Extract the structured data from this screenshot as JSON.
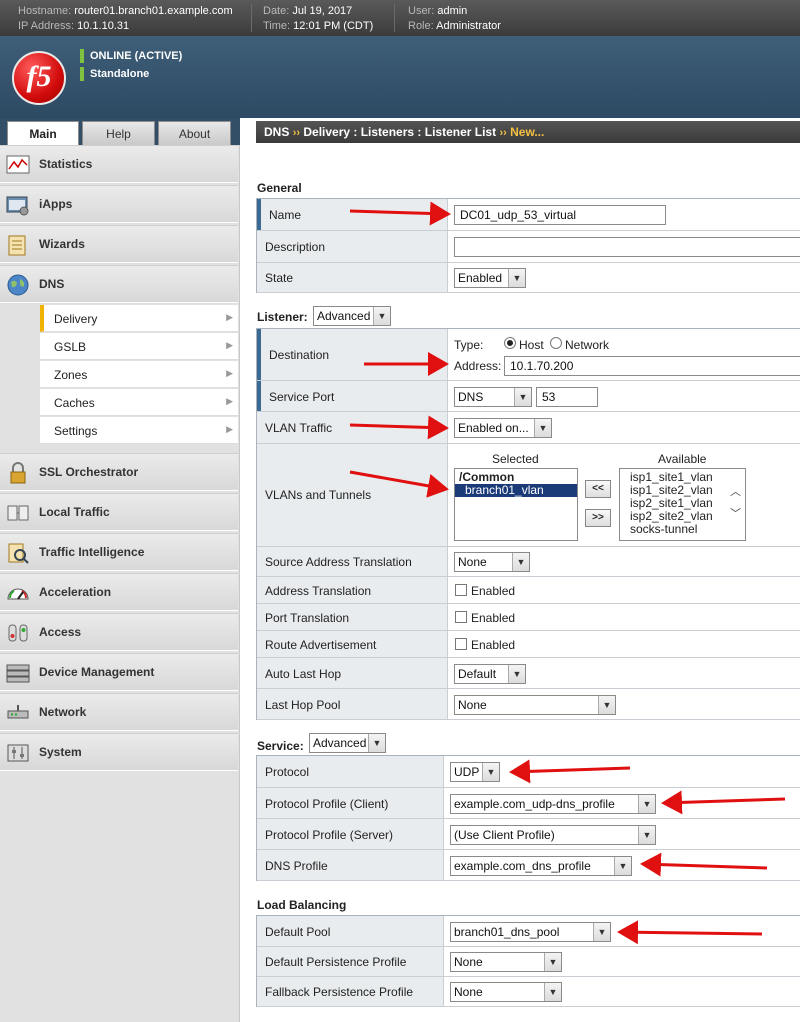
{
  "topbar": {
    "hostname_label": "Hostname:",
    "hostname": "router01.branch01.example.com",
    "ip_label": "IP Address:",
    "ip": "10.1.10.31",
    "date_label": "Date:",
    "date": "Jul 19, 2017",
    "time_label": "Time:",
    "time": "12:01 PM (CDT)",
    "user_label": "User:",
    "user": "admin",
    "role_label": "Role:",
    "role": "Administrator"
  },
  "header": {
    "logo": "f5",
    "status1": "ONLINE (ACTIVE)",
    "status2": "Standalone",
    "status_color": "#7fc242"
  },
  "tabs": {
    "main": "Main",
    "help": "Help",
    "about": "About"
  },
  "breadcrumb": {
    "p1": "DNS",
    "sep": "››",
    "p2": "Delivery : Listeners : Listener List",
    "p3": "New..."
  },
  "sidebar": {
    "items": [
      "Statistics",
      "iApps",
      "Wizards",
      "DNS",
      "SSL Orchestrator",
      "Local Traffic",
      "Traffic Intelligence",
      "Acceleration",
      "Access",
      "Device Management",
      "Network",
      "System"
    ],
    "dns_sub": [
      "Delivery",
      "GSLB",
      "Zones",
      "Caches",
      "Settings"
    ]
  },
  "general": {
    "title": "General",
    "name_label": "Name",
    "name_value": "DC01_udp_53_virtual",
    "desc_label": "Description",
    "desc_value": "",
    "state_label": "State",
    "state_value": "Enabled"
  },
  "listener": {
    "title": "Listener:",
    "mode": "Advanced",
    "dest_label": "Destination",
    "type_label": "Type:",
    "host": "Host",
    "network": "Network",
    "address_label": "Address:",
    "address": "10.1.70.200",
    "port_label": "Service Port",
    "port_select": "DNS",
    "port_value": "53",
    "vlan_label": "VLAN Traffic",
    "vlan_value": "Enabled on...",
    "vlans_label": "VLANs and Tunnels",
    "selected_hdr": "Selected",
    "available_hdr": "Available",
    "selected": [
      "/Common",
      "branch01_vlan"
    ],
    "available": [
      "isp1_site1_vlan",
      "isp1_site2_vlan",
      "isp2_site1_vlan",
      "isp2_site2_vlan",
      "socks-tunnel"
    ],
    "btn_left": "<<",
    "btn_right": ">>",
    "sat_label": "Source Address Translation",
    "sat_value": "None",
    "addr_trans_label": "Address Translation",
    "port_trans_label": "Port Translation",
    "route_adv_label": "Route Advertisement",
    "enabled": "Enabled",
    "auto_last_hop_label": "Auto Last Hop",
    "auto_last_hop_value": "Default",
    "last_hop_pool_label": "Last Hop Pool",
    "last_hop_pool_value": "None"
  },
  "service": {
    "title": "Service:",
    "mode": "Advanced",
    "protocol_label": "Protocol",
    "protocol_value": "UDP",
    "client_label": "Protocol Profile (Client)",
    "client_value": "example.com_udp-dns_profile",
    "server_label": "Protocol Profile (Server)",
    "server_value": "(Use Client Profile)",
    "dns_label": "DNS Profile",
    "dns_value": "example.com_dns_profile"
  },
  "lb": {
    "title": "Load Balancing",
    "pool_label": "Default Pool",
    "pool_value": "branch01_dns_pool",
    "persist_label": "Default Persistence Profile",
    "persist_value": "None",
    "fallback_label": "Fallback Persistence Profile",
    "fallback_value": "None"
  },
  "colors": {
    "annotation_arrow": "#e01010",
    "highlight_bar": "#3b6b93",
    "active_sub": "#f0b400"
  }
}
